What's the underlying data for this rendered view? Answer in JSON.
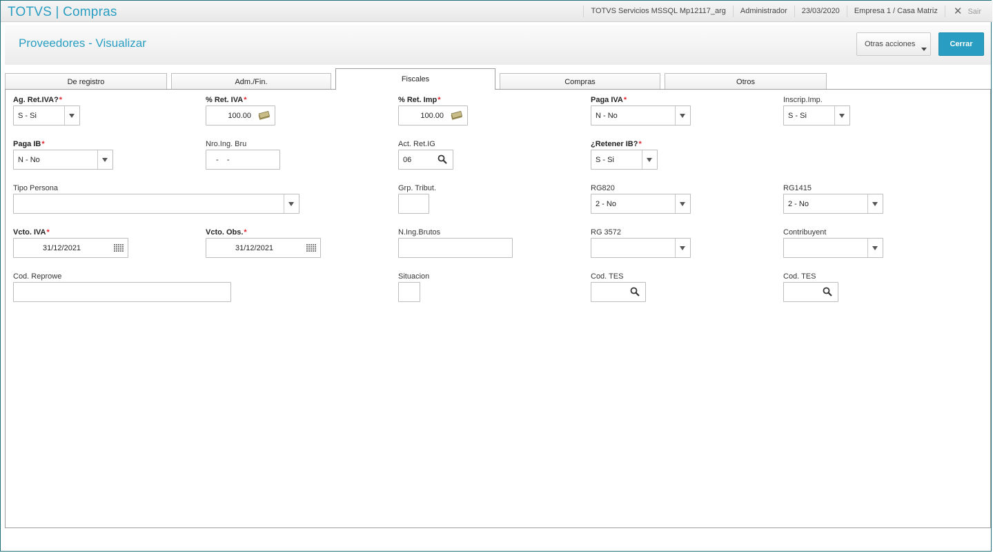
{
  "topbar": {
    "app_title": "TOTVS | Compras",
    "environment": "TOTVS Servicios MSSQL Mp12117_arg",
    "user": "Administrador",
    "date": "23/03/2020",
    "company": "Empresa 1 / Casa Matriz",
    "exit_label": "Sair"
  },
  "header": {
    "title": "Proveedores - Visualizar",
    "other_actions_label": "Otras acciones",
    "close_label": "Cerrar"
  },
  "tabs": [
    {
      "label": "De registro",
      "active": false
    },
    {
      "label": "Adm./Fin.",
      "active": false
    },
    {
      "label": "Fiscales",
      "active": true
    },
    {
      "label": "Compras",
      "active": false
    },
    {
      "label": "Otros",
      "active": false
    }
  ],
  "form": {
    "ag_ret_iva": {
      "label": "Ag. Ret.IVA?",
      "required": true,
      "value": "S - Si"
    },
    "pct_ret_iva": {
      "label": "% Ret. IVA",
      "required": true,
      "value": "100.00"
    },
    "pct_ret_imp": {
      "label": "% Ret. Imp",
      "required": true,
      "value": "100.00"
    },
    "paga_iva": {
      "label": "Paga IVA",
      "required": true,
      "value": "N - No"
    },
    "inscrip_imp": {
      "label": "Inscrip.Imp.",
      "required": false,
      "value": "S - Si"
    },
    "paga_ib": {
      "label": "Paga IB",
      "required": true,
      "value": "N - No"
    },
    "nro_ing_bru": {
      "label": "Nro.Ing. Bru",
      "required": false,
      "value": "-    -"
    },
    "act_ret_ig": {
      "label": "Act. Ret.IG",
      "required": false,
      "value": "06"
    },
    "retener_ib": {
      "label": "¿Retener IB?",
      "required": true,
      "value": "S - Si"
    },
    "tipo_persona": {
      "label": "Tipo Persona",
      "required": false,
      "value": ""
    },
    "grp_tribut": {
      "label": "Grp. Tribut.",
      "required": false,
      "value": ""
    },
    "rg820": {
      "label": "RG820",
      "required": false,
      "value": "2 - No"
    },
    "rg1415": {
      "label": "RG1415",
      "required": false,
      "value": "2 - No"
    },
    "vcto_iva": {
      "label": "Vcto. IVA",
      "required": true,
      "value": "31/12/2021"
    },
    "vcto_obs": {
      "label": "Vcto. Obs.",
      "required": true,
      "value": "31/12/2021"
    },
    "n_ing_brutos": {
      "label": "N.Ing.Brutos",
      "required": false,
      "value": ""
    },
    "rg3572": {
      "label": "RG 3572",
      "required": false,
      "value": ""
    },
    "contribuyent": {
      "label": "Contribuyent",
      "required": false,
      "value": ""
    },
    "cod_reprowe": {
      "label": "Cod. Reprowe",
      "required": false,
      "value": ""
    },
    "situacion": {
      "label": "Situacion",
      "required": false,
      "value": ""
    },
    "cod_tes_1": {
      "label": "Cod. TES",
      "required": false,
      "value": ""
    },
    "cod_tes_2": {
      "label": "Cod. TES",
      "required": false,
      "value": ""
    }
  },
  "required_marker": "*",
  "icons": {
    "select": "chevron-down-icon",
    "lookup": "search-icon",
    "calculator": "money-icon",
    "date": "calendar-icon",
    "close": "close-icon"
  },
  "colors": {
    "accent": "#2a9ec2",
    "required": "#e0242c"
  }
}
